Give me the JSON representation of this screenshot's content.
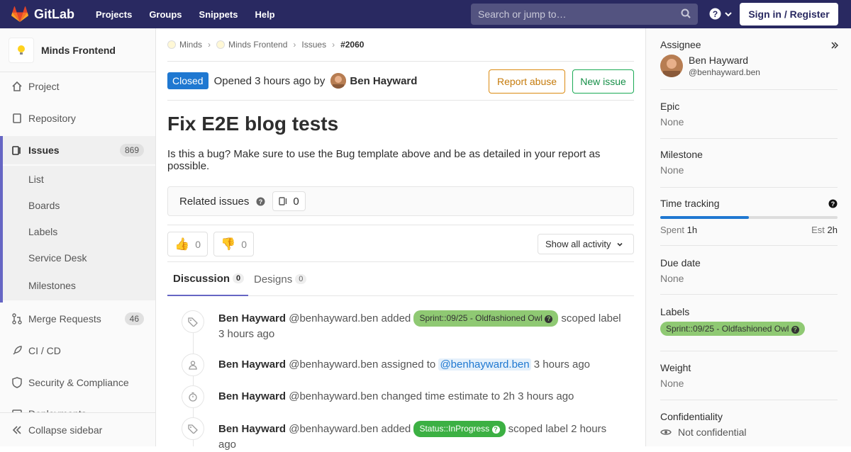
{
  "topbar": {
    "logo": "GitLab",
    "nav": [
      "Projects",
      "Groups",
      "Snippets",
      "Help"
    ],
    "search_placeholder": "Search or jump to…",
    "signin": "Sign in / Register"
  },
  "sidebar": {
    "project_name": "Minds Frontend",
    "items": {
      "project": "Project",
      "repository": "Repository",
      "issues": "Issues",
      "issues_count": "869",
      "merge_requests": "Merge Requests",
      "mr_count": "46",
      "cicd": "CI / CD",
      "security": "Security & Compliance",
      "deployments": "Deployments"
    },
    "subitems": [
      "List",
      "Boards",
      "Labels",
      "Service Desk",
      "Milestones"
    ],
    "collapse": "Collapse sidebar"
  },
  "breadcrumb": [
    "Minds",
    "Minds Frontend",
    "Issues",
    "#2060"
  ],
  "issue": {
    "status": "Closed",
    "opened_prefix": "Opened 3 hours ago by",
    "author": "Ben Hayward",
    "report_abuse": "Report abuse",
    "new_issue": "New issue",
    "title": "Fix E2E blog tests",
    "description": "Is this a bug? Make sure to use the Bug template above and be as detailed in your report as possible.",
    "related_label": "Related issues",
    "related_count": "0",
    "thumbs_up": "0",
    "thumbs_down": "0",
    "activity_filter": "Show all activity"
  },
  "tabs": [
    {
      "label": "Discussion",
      "count": "0"
    },
    {
      "label": "Designs",
      "count": "0"
    }
  ],
  "notes": [
    {
      "author": "Ben Hayward",
      "handle": "@benhayward.ben",
      "action": "added",
      "label": "Sprint::09/25 - Oldfashioned Owl",
      "suffix": "scoped label",
      "time": "3 hours ago"
    },
    {
      "author": "Ben Hayward",
      "handle": "@benhayward.ben",
      "action": "assigned to",
      "mention": "@benhayward.ben",
      "time": "3 hours ago"
    },
    {
      "author": "Ben Hayward",
      "handle": "@benhayward.ben",
      "action": "changed time estimate to 2h",
      "time": "3 hours ago"
    },
    {
      "author": "Ben Hayward",
      "handle": "@benhayward.ben",
      "action": "added",
      "label": "Status::InProgress",
      "suffix": "scoped label",
      "time": "2 hours ago"
    }
  ],
  "right_sidebar": {
    "assignee_title": "Assignee",
    "assignee_name": "Ben Hayward",
    "assignee_handle": "@benhayward.ben",
    "epic_title": "Epic",
    "epic_value": "None",
    "milestone_title": "Milestone",
    "milestone_value": "None",
    "time_title": "Time tracking",
    "spent_label": "Spent",
    "spent_value": "1h",
    "est_label": "Est",
    "est_value": "2h",
    "time_progress": 0.5,
    "due_title": "Due date",
    "due_value": "None",
    "labels_title": "Labels",
    "label_value": "Sprint::09/25 - Oldfashioned Owl",
    "weight_title": "Weight",
    "weight_value": "None",
    "conf_title": "Confidentiality",
    "conf_value": "Not confidential"
  }
}
